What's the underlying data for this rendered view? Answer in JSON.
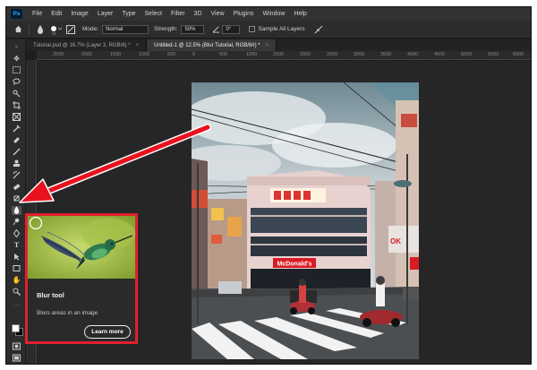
{
  "app": {
    "logo": "Ps"
  },
  "menu": [
    "File",
    "Edit",
    "Image",
    "Layer",
    "Type",
    "Select",
    "Filter",
    "3D",
    "View",
    "Plugins",
    "Window",
    "Help"
  ],
  "options": {
    "mode_label": "Mode:",
    "mode_value": "Normal",
    "strength_label": "Strength:",
    "strength_value": "50%",
    "angle_value": "0°",
    "sample_all_layers": "Sample All Layers"
  },
  "tabs": [
    {
      "label": "Tutorial.psd @ 16.7% (Layer 3, RGB/8) *",
      "close": "×"
    },
    {
      "label": "Untitled-1 @ 12.5% (Blur Tutorial, RGB/8#) *",
      "close": "×"
    }
  ],
  "ruler": [
    "2500",
    "2000",
    "1500",
    "1000",
    "500",
    "0",
    "500",
    "1000",
    "1500",
    "2000",
    "2500",
    "3000",
    "3500",
    "4000",
    "4500",
    "5000",
    "5500",
    "6000"
  ],
  "tooltip": {
    "title": "Blur tool",
    "description": "Blurs areas in an image",
    "button": "Learn more"
  },
  "photo": {
    "sign": "McDonald's",
    "sign_color": "#d91c24",
    "ok_sign": "OK"
  },
  "colors": {
    "highlight": "#e1202f",
    "ui_bg": "#1e1e1e"
  },
  "icons": {
    "home": "home-icon",
    "brush_preset": "brush-preset-icon",
    "arrow": "red-arrow"
  }
}
